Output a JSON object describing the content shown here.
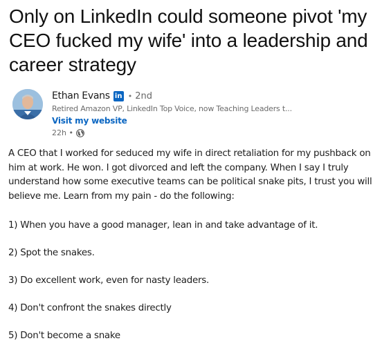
{
  "headline": "Only on LinkedIn could someone pivot 'my CEO fucked my wife' into a leadership and career strategy",
  "post": {
    "author_name": "Ethan Evans",
    "linkedin_badge": "in",
    "separator": "•",
    "connection_degree": "2nd",
    "author_headline": "Retired Amazon VP, LinkedIn Top Voice, now Teaching Leaders t...",
    "website_link": "Visit my website",
    "time_ago": "22h •",
    "body_paragraph": "A CEO that I worked for seduced my wife in direct retaliation for my pushback on him at work. He won. I got divorced and left the company. When I say I truly understand how some executive teams can be political snake pits, I trust you will believe me. Learn from my pain - do the following:",
    "list_items": [
      "1) When you have a good manager, lean in and take advantage of it.",
      "2) Spot the snakes.",
      "3) Do excellent work, even for nasty leaders.",
      "4) Don't confront the snakes directly",
      "5) Don't become a snake"
    ]
  },
  "colors": {
    "link": "#0a66c2",
    "linkedin_brand": "#0a66c2",
    "muted_text": "#6b6b6b"
  },
  "icons": {
    "badge": "linkedin-logo-icon",
    "visibility": "globe-icon"
  }
}
